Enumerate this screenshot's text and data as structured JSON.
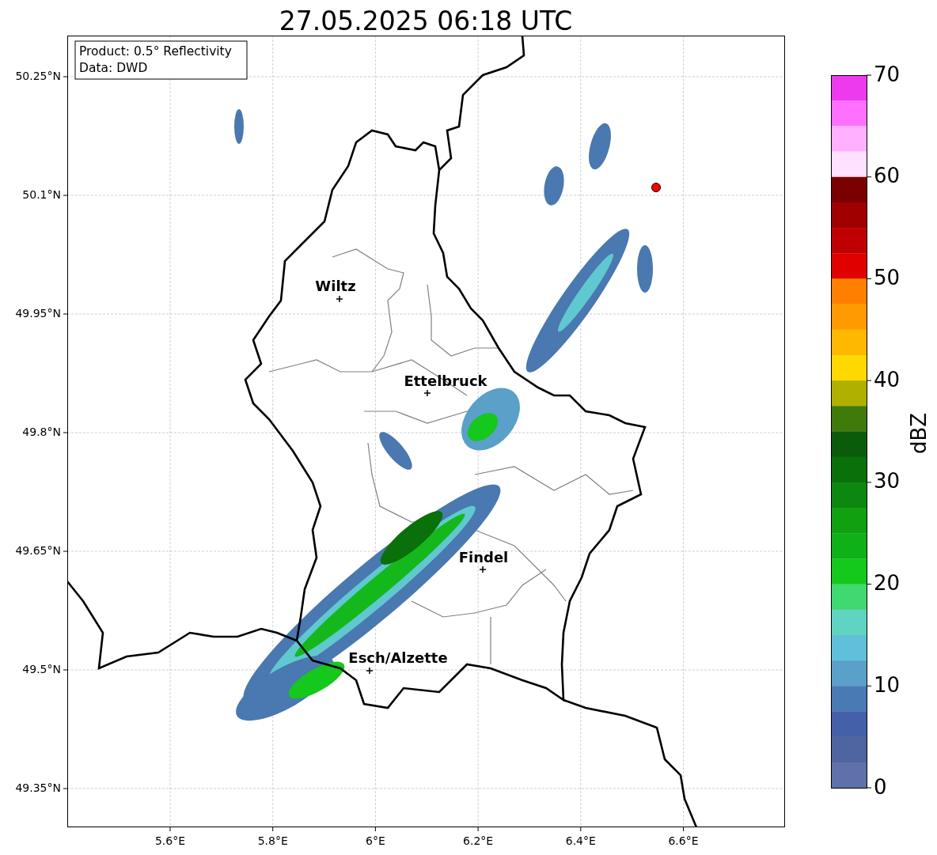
{
  "title": "27.05.2025 06:18 UTC",
  "map": {
    "legend": [
      "Product: 0.5° Reflectivity",
      "Data: DWD"
    ],
    "lat_ticks": [
      "50.25°N",
      "50.1°N",
      "49.95°N",
      "49.8°N",
      "49.65°N",
      "49.5°N",
      "49.35°N"
    ],
    "lon_ticks": [
      "5.6°E",
      "5.8°E",
      "6°E",
      "6.2°E",
      "6.4°E",
      "6.6°E"
    ],
    "places": [
      {
        "name": "Wiltz"
      },
      {
        "name": "Ettelbruck"
      },
      {
        "name": "Findel"
      },
      {
        "name": "Esch/Alzette"
      }
    ]
  },
  "colorbar": {
    "label": "dBZ",
    "ticks": [
      "70",
      "60",
      "50",
      "40",
      "30",
      "20",
      "10",
      "0"
    ],
    "segments": [
      {
        "color": "#ee3aee"
      },
      {
        "color": "#ff70ff"
      },
      {
        "color": "#ffb0ff"
      },
      {
        "color": "#ffe0ff"
      },
      {
        "color": "#7a0000"
      },
      {
        "color": "#a00000"
      },
      {
        "color": "#c00000"
      },
      {
        "color": "#e00000"
      },
      {
        "color": "#ff8000"
      },
      {
        "color": "#ff9a00"
      },
      {
        "color": "#ffb800"
      },
      {
        "color": "#ffd800"
      },
      {
        "color": "#b0b000"
      },
      {
        "color": "#407a0a"
      },
      {
        "color": "#0a5c0a"
      },
      {
        "color": "#0a700a"
      },
      {
        "color": "#0c8810"
      },
      {
        "color": "#10a010"
      },
      {
        "color": "#10b018"
      },
      {
        "color": "#14c81c"
      },
      {
        "color": "#40d870"
      },
      {
        "color": "#60d4c0"
      },
      {
        "color": "#60c0dc"
      },
      {
        "color": "#5aa0c8"
      },
      {
        "color": "#4a7ab4"
      },
      {
        "color": "#4460a8"
      },
      {
        "color": "#5064a0"
      },
      {
        "color": "#6070a8"
      }
    ]
  }
}
